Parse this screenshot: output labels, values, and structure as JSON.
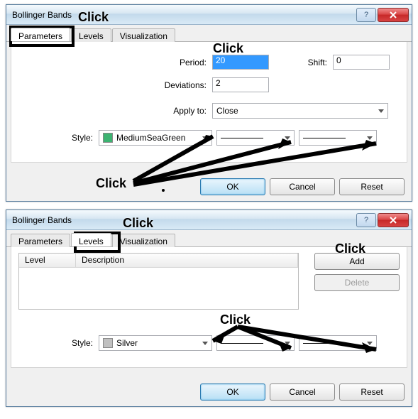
{
  "dialog1": {
    "title": "Bollinger Bands",
    "tabs": [
      "Parameters",
      "Levels",
      "Visualization"
    ],
    "active_tab": 0,
    "fields": {
      "period_label": "Period:",
      "period_value": "20",
      "shift_label": "Shift:",
      "shift_value": "0",
      "deviations_label": "Deviations:",
      "deviations_value": "2",
      "apply_to_label": "Apply to:",
      "apply_to_value": "Close",
      "style_label": "Style:",
      "style_color_name": "MediumSeaGreen",
      "style_color_hex": "#3cb371"
    },
    "buttons": {
      "ok": "OK",
      "cancel": "Cancel",
      "reset": "Reset"
    }
  },
  "dialog2": {
    "title": "Bollinger Bands",
    "tabs": [
      "Parameters",
      "Levels",
      "Visualization"
    ],
    "active_tab": 1,
    "list": {
      "col1": "Level",
      "col2": "Description"
    },
    "side": {
      "add": "Add",
      "delete": "Delete"
    },
    "style_label": "Style:",
    "style_color_name": "Silver",
    "style_color_hex": "#c0c0c0",
    "buttons": {
      "ok": "OK",
      "cancel": "Cancel",
      "reset": "Reset"
    }
  },
  "annotations": {
    "click": "Click"
  }
}
